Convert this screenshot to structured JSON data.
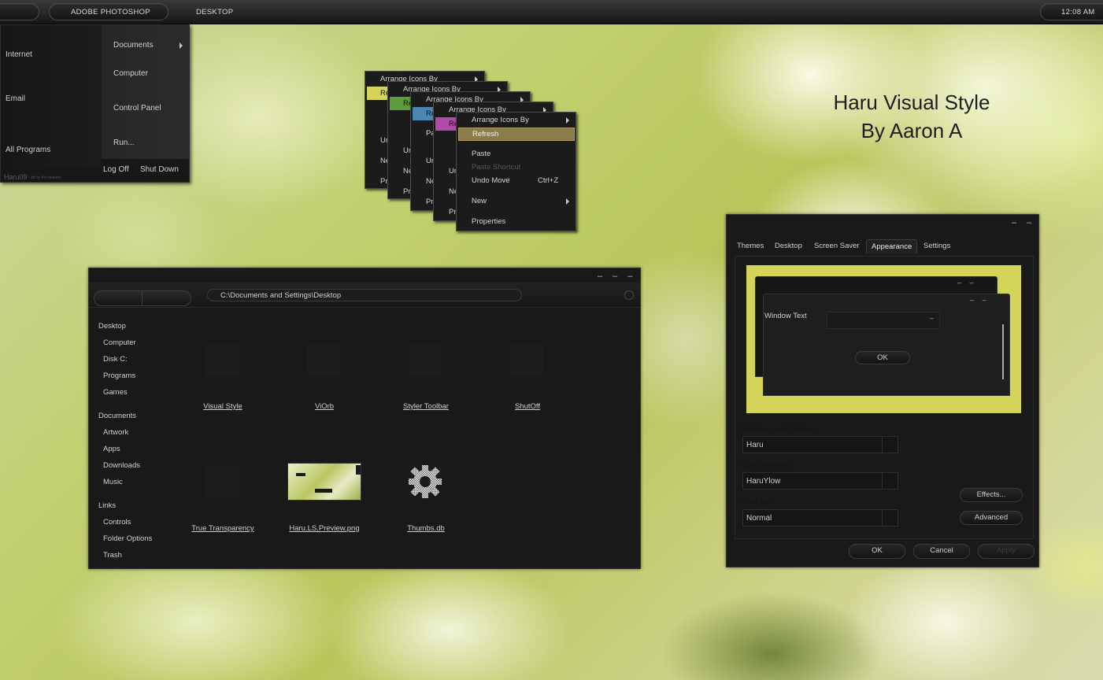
{
  "taskbar": {
    "active_app": "Adobe Photoshop",
    "desktop_label": "Desktop",
    "clock": "12:08 AM"
  },
  "start_menu": {
    "left_items": [
      "Internet",
      "Email",
      "All Programs"
    ],
    "right_items": [
      "Documents",
      "Computer",
      "Control Panel",
      "Run..."
    ],
    "log_off": "Log Off",
    "shut_down": "Shut Down",
    "brand": "Haru09",
    "brand_tagline": "art by the makers"
  },
  "context_menus": {
    "arrange_icons_by": "Arrange Icons By",
    "refresh": "Refresh",
    "paste": "Paste",
    "paste_shortcut": "Paste Shortcut",
    "undo_move": "Undo Move",
    "undo_shortcut": "Ctrl+Z",
    "new": "New",
    "properties": "Properties",
    "stub_re": "Re",
    "stub_pa": "Pa",
    "stub_un": "Un",
    "stub_ne": "Ne",
    "stub_pr": "Pr",
    "highlight_colors": [
      "#d4d35a",
      "#5c9c3c",
      "#4a86b4",
      "#b04aa6",
      "#8b7d4a"
    ]
  },
  "watermark": {
    "line1": "Haru Visual Style",
    "line2": "By Aaron A"
  },
  "explorer": {
    "controls": "– – –",
    "address": "C:\\Documents and Settings\\Desktop",
    "nav": [
      {
        "label": "Desktop",
        "level": 0
      },
      {
        "label": "Computer",
        "level": 1
      },
      {
        "label": "Disk C:",
        "level": 1
      },
      {
        "label": "Programs",
        "level": 1
      },
      {
        "label": "Games",
        "level": 1
      },
      {
        "label": "Documents",
        "level": 0
      },
      {
        "label": "Artwork",
        "level": 1
      },
      {
        "label": "Apps",
        "level": 1
      },
      {
        "label": "Downloads",
        "level": 1
      },
      {
        "label": "Music",
        "level": 1
      },
      {
        "label": "Links",
        "level": 0
      },
      {
        "label": "Controls",
        "level": 1
      },
      {
        "label": "Folder Options",
        "level": 1
      },
      {
        "label": "Trash",
        "level": 1
      }
    ],
    "files": [
      "Visual Style",
      "ViOrb",
      "Styler Toolbar",
      "ShutOff",
      "True Transparency",
      "Haru.LS.Preview.png",
      "Thumbs.db"
    ]
  },
  "display_properties": {
    "controls": "– –",
    "tabs": [
      "Themes",
      "Desktop",
      "Screen Saver",
      "Appearance",
      "Settings"
    ],
    "active_tab": "Appearance",
    "preview": {
      "window_text": "Window Text",
      "ok": "OK",
      "accent": "#d4d35a"
    },
    "windows_and_buttons_label": "Windows and buttons:",
    "windows_and_buttons_value": "Haru",
    "color_scheme_label": "Color scheme:",
    "color_scheme_value": "HaruYlow",
    "font_size_label": "Font size:",
    "font_size_value": "Normal",
    "effects_button": "Effects...",
    "advanced_button": "Advanced",
    "ok_button": "OK",
    "cancel_button": "Cancel",
    "apply_button": "Apply"
  }
}
